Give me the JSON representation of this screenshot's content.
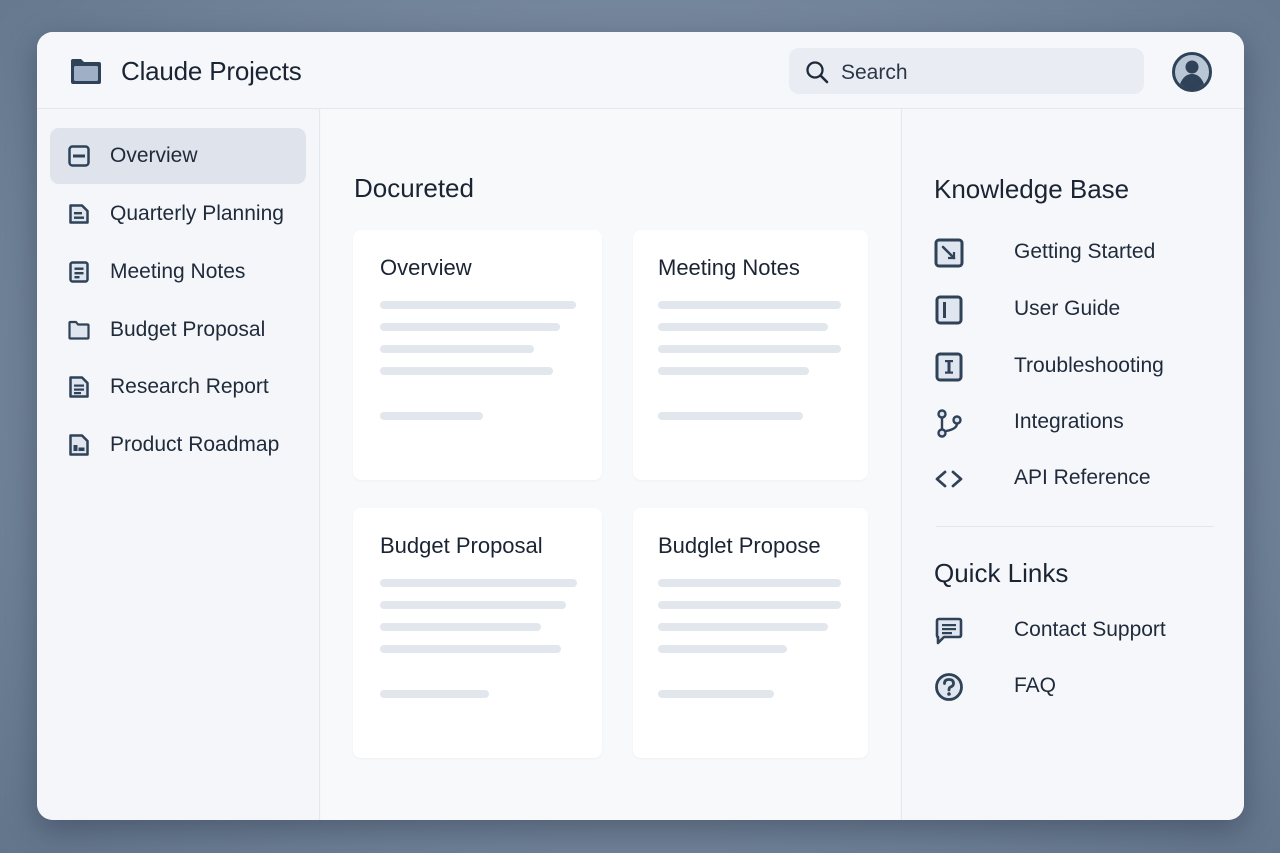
{
  "app": {
    "title": "Claude Projects"
  },
  "search": {
    "placeholder": "Search"
  },
  "sidebar": {
    "items": [
      {
        "label": "Overview",
        "icon": "document-icon",
        "active": true
      },
      {
        "label": "Quarterly Planning",
        "icon": "document-icon"
      },
      {
        "label": "Meeting Notes",
        "icon": "notes-icon"
      },
      {
        "label": "Budget Proposal",
        "icon": "folder-icon"
      },
      {
        "label": "Research Report",
        "icon": "document-icon"
      },
      {
        "label": "Product Roadmap",
        "icon": "image-document-icon"
      }
    ]
  },
  "main": {
    "title": "Docureted",
    "cards": [
      {
        "title": "Overview"
      },
      {
        "title": "Meeting Notes"
      },
      {
        "title": "Budget Proposal"
      },
      {
        "title": "Budglet Propose"
      }
    ]
  },
  "knowledge_base": {
    "title": "Knowledge Base",
    "items": [
      {
        "label": "Getting Started",
        "icon": "arrow-box-icon"
      },
      {
        "label": "User Guide",
        "icon": "book-icon"
      },
      {
        "label": "Troubleshooting",
        "icon": "info-box-icon"
      },
      {
        "label": "Integrations",
        "icon": "branch-icon"
      },
      {
        "label": "API Reference",
        "icon": "code-icon"
      }
    ]
  },
  "quick_links": {
    "title": "Quick Links",
    "items": [
      {
        "label": "Contact Support",
        "icon": "chat-icon"
      },
      {
        "label": "FAQ",
        "icon": "question-icon"
      }
    ]
  },
  "colors": {
    "accent": "#2f4258",
    "icon_fill": "#dfe6ef",
    "active_bg": "#dfe4ec",
    "skeleton": "#e2e6ed"
  }
}
